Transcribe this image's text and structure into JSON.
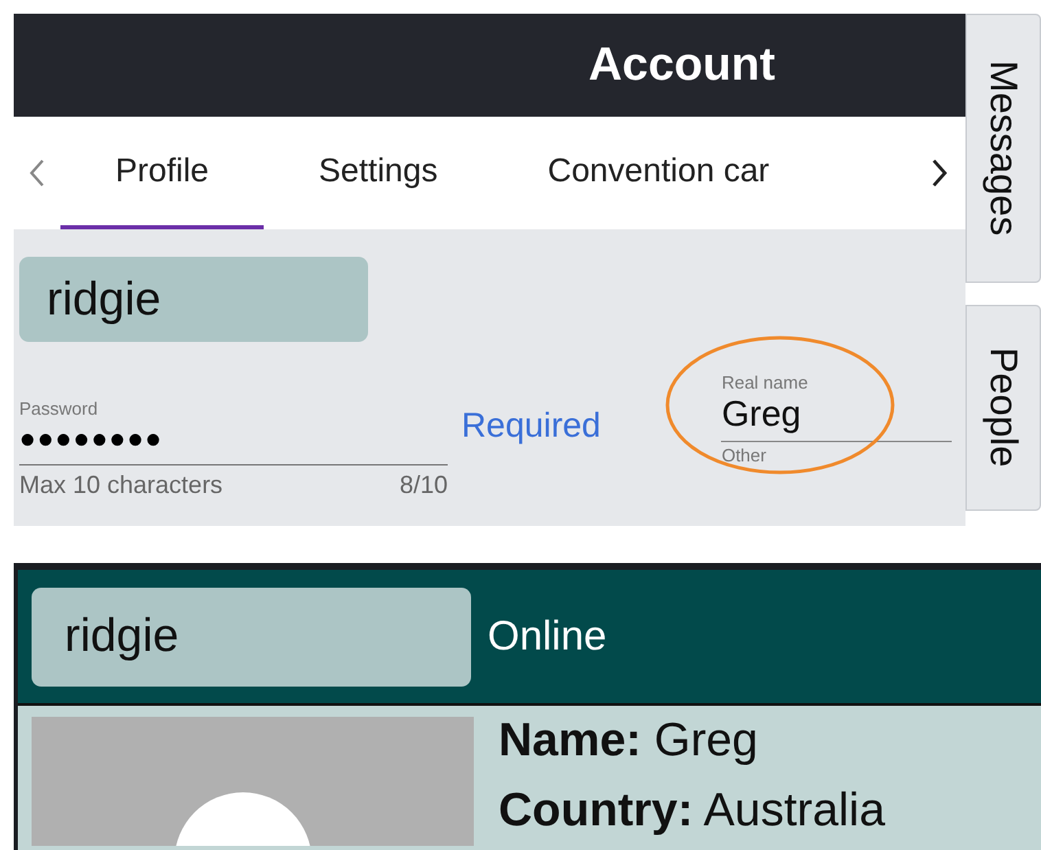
{
  "account": {
    "title": "Account",
    "tabs": [
      {
        "label": "Profile",
        "selected": true
      },
      {
        "label": "Settings",
        "selected": false
      },
      {
        "label": "Convention car",
        "selected": false
      }
    ],
    "username": "ridgie",
    "password": {
      "label": "Password",
      "value": "●●●●●●●●",
      "hint": "Max 10 characters",
      "counter": "8/10"
    },
    "required": "Required",
    "real_name": {
      "label": "Real name",
      "value": "Greg"
    },
    "other_label": "Other",
    "side_tabs": [
      "Messages",
      "People"
    ]
  },
  "profile_card": {
    "username": "ridgie",
    "status": "Online",
    "details": [
      {
        "label": "Name:",
        "value": "Greg"
      },
      {
        "label": "Country:",
        "value": "Australia"
      }
    ]
  }
}
